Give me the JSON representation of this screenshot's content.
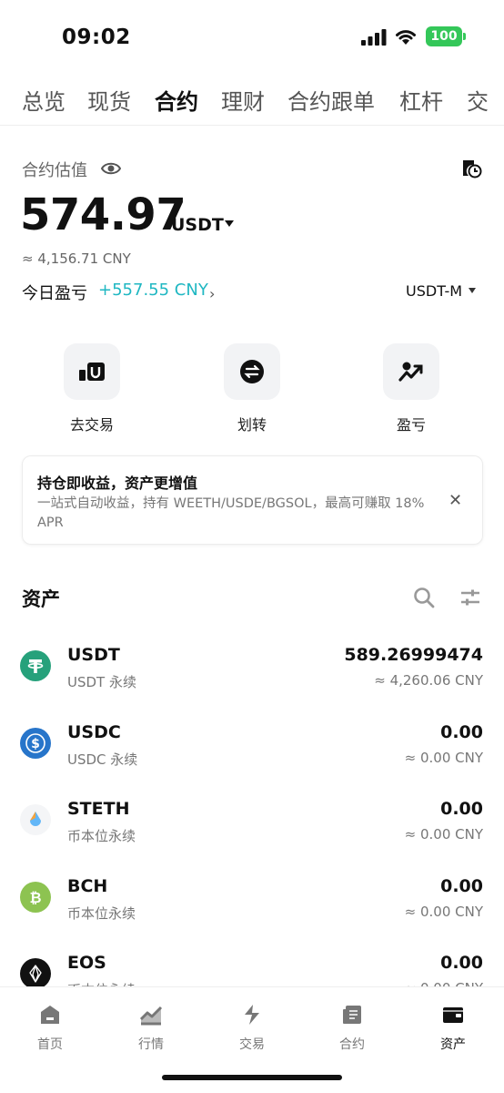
{
  "status_bar": {
    "time": "09:02",
    "battery": "100"
  },
  "tabs": [
    {
      "label": "总览",
      "active": false
    },
    {
      "label": "现货",
      "active": false
    },
    {
      "label": "合约",
      "active": true
    },
    {
      "label": "理财",
      "active": false
    },
    {
      "label": "合约跟单",
      "active": false
    },
    {
      "label": "杠杆",
      "active": false
    },
    {
      "label": "交",
      "active": false
    }
  ],
  "valuation": {
    "label": "合约估值",
    "value": "574.97",
    "unit": "USDT",
    "cny_approx": "≈ 4,156.71 CNY",
    "pnl_label": "今日盈亏",
    "pnl_value": "+557.55 CNY",
    "margin_mode": "USDT-M"
  },
  "actions": [
    {
      "label": "去交易",
      "icon": "trade-u-icon"
    },
    {
      "label": "划转",
      "icon": "transfer-icon"
    },
    {
      "label": "盈亏",
      "icon": "pnl-chart-icon"
    }
  ],
  "promo": {
    "title": "持仓即收益，资产更增值",
    "desc": "一站式自动收益，持有 WEETH/USDE/BGSOL，最高可赚取 18% APR",
    "close": "✕"
  },
  "assets_section": {
    "title": "资产"
  },
  "assets": [
    {
      "name": "USDT",
      "sub": "USDT 永续",
      "amount": "589.26999474",
      "cny": "≈ 4,260.06 CNY",
      "icon": "tether-icon",
      "color": "#26a17b"
    },
    {
      "name": "USDC",
      "sub": "USDC 永续",
      "amount": "0.00",
      "cny": "≈ 0.00 CNY",
      "icon": "usdc-icon",
      "color": "#2775ca"
    },
    {
      "name": "STETH",
      "sub": "币本位永续",
      "amount": "0.00",
      "cny": "≈ 0.00 CNY",
      "icon": "steth-icon",
      "color": "#f4f5f7"
    },
    {
      "name": "BCH",
      "sub": "币本位永续",
      "amount": "0.00",
      "cny": "≈ 0.00 CNY",
      "icon": "bch-icon",
      "color": "#8dc351"
    },
    {
      "name": "EOS",
      "sub": "币本位永续",
      "amount": "0.00",
      "cny": "≈ 0.00 CNY",
      "icon": "eos-icon",
      "color": "#111111"
    }
  ],
  "bottom_nav": [
    {
      "label": "首页",
      "icon": "home-icon",
      "active": false
    },
    {
      "label": "行情",
      "icon": "market-icon",
      "active": false
    },
    {
      "label": "交易",
      "icon": "trade-icon",
      "active": false
    },
    {
      "label": "合约",
      "icon": "futures-icon",
      "active": false
    },
    {
      "label": "资产",
      "icon": "wallet-icon",
      "active": true
    }
  ],
  "colors": {
    "accent_pnl": "#1fb7c2",
    "battery": "#34c759"
  }
}
